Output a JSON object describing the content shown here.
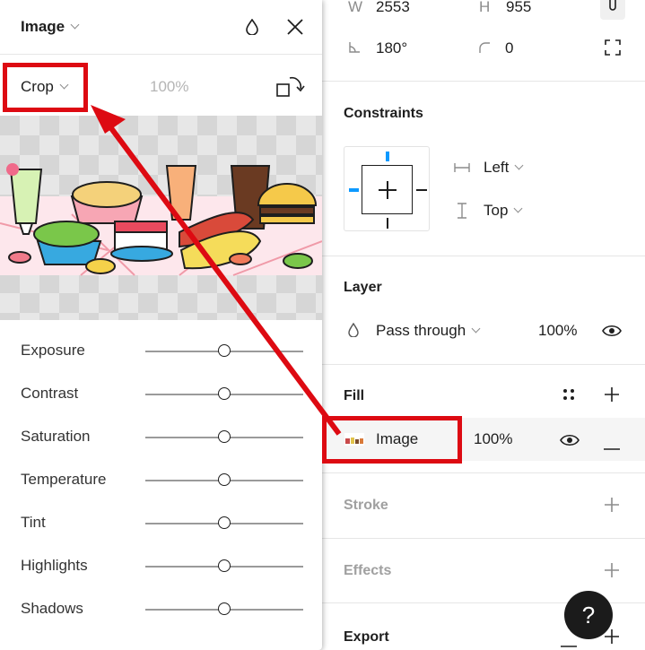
{
  "dimensions": {
    "w_label": "W",
    "w_value": "2553",
    "h_label": "H",
    "h_value": "955",
    "rotation_value": "180°",
    "corner_value": "0"
  },
  "constraints": {
    "title": "Constraints",
    "horizontal": "Left",
    "vertical": "Top"
  },
  "layer": {
    "title": "Layer",
    "blend": "Pass through",
    "opacity": "100%"
  },
  "fill": {
    "title": "Fill",
    "type": "Image",
    "opacity": "100%"
  },
  "stroke": {
    "title": "Stroke"
  },
  "effects": {
    "title": "Effects"
  },
  "export": {
    "title": "Export"
  },
  "help": {
    "label": "?"
  },
  "image_panel": {
    "title": "Image",
    "mode": "Crop",
    "scale": "100%",
    "adjustments": [
      {
        "label": "Exposure",
        "value": 0.5
      },
      {
        "label": "Contrast",
        "value": 0.5
      },
      {
        "label": "Saturation",
        "value": 0.5
      },
      {
        "label": "Temperature",
        "value": 0.5
      },
      {
        "label": "Tint",
        "value": 0.5
      },
      {
        "label": "Highlights",
        "value": 0.5
      },
      {
        "label": "Shadows",
        "value": 0.5
      }
    ]
  },
  "colors": {
    "annotation_red": "#dd0a12",
    "constraint_blue": "#0d99ff"
  }
}
